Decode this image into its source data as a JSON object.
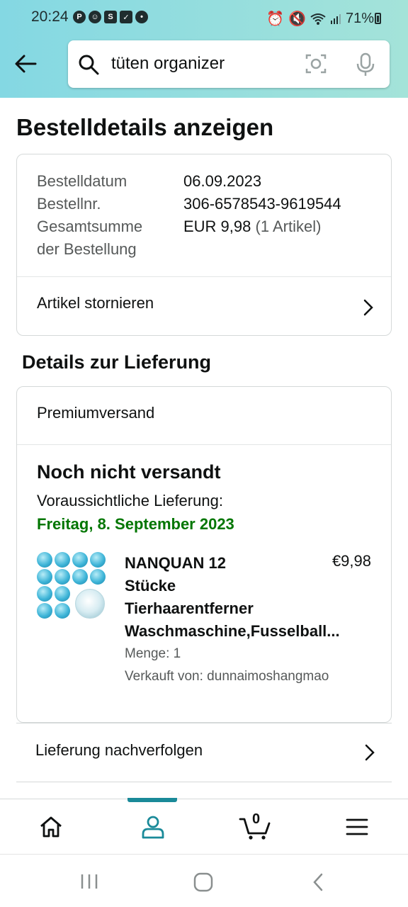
{
  "status_bar": {
    "time": "20:24",
    "battery": "71%"
  },
  "search": {
    "query": "tüten organizer"
  },
  "page": {
    "title": "Bestelldetails anzeigen"
  },
  "order": {
    "date_label": "Bestelldatum",
    "date_value": "06.09.2023",
    "number_label": "Bestellnr.",
    "number_value": "306-6578543-9619544",
    "total_label_line1": "Gesamtsumme",
    "total_label_line2": "der Bestellung",
    "total_value": "EUR 9,98",
    "total_items": "(1 Artikel)",
    "cancel_link": "Artikel stornieren"
  },
  "delivery": {
    "heading": "Details zur Lieferung",
    "shipping_method": "Premiumversand",
    "status": "Noch nicht versandt",
    "expected_label": "Voraussichtliche Lieferung:",
    "expected_date": "Freitag, 8. September 2023",
    "item": {
      "title_line1": "NANQUAN 12",
      "title_line2": "Stücke",
      "title_line3": "Tierhaarentferner",
      "title_line4": "Waschmaschine,Fusselball...",
      "price": "€9,98",
      "quantity": "Menge: 1",
      "seller": "Verkauft von: dunnaimoshangmao"
    },
    "track_link": "Lieferung nachverfolgen"
  },
  "bottom_nav": {
    "cart_count": "0",
    "active_tab": "account"
  },
  "colors": {
    "header_gradient_start": "#84d8e3",
    "header_gradient_end": "#a4e3d9",
    "delivery_date_green": "#007600",
    "active_teal": "#1a8a99"
  }
}
